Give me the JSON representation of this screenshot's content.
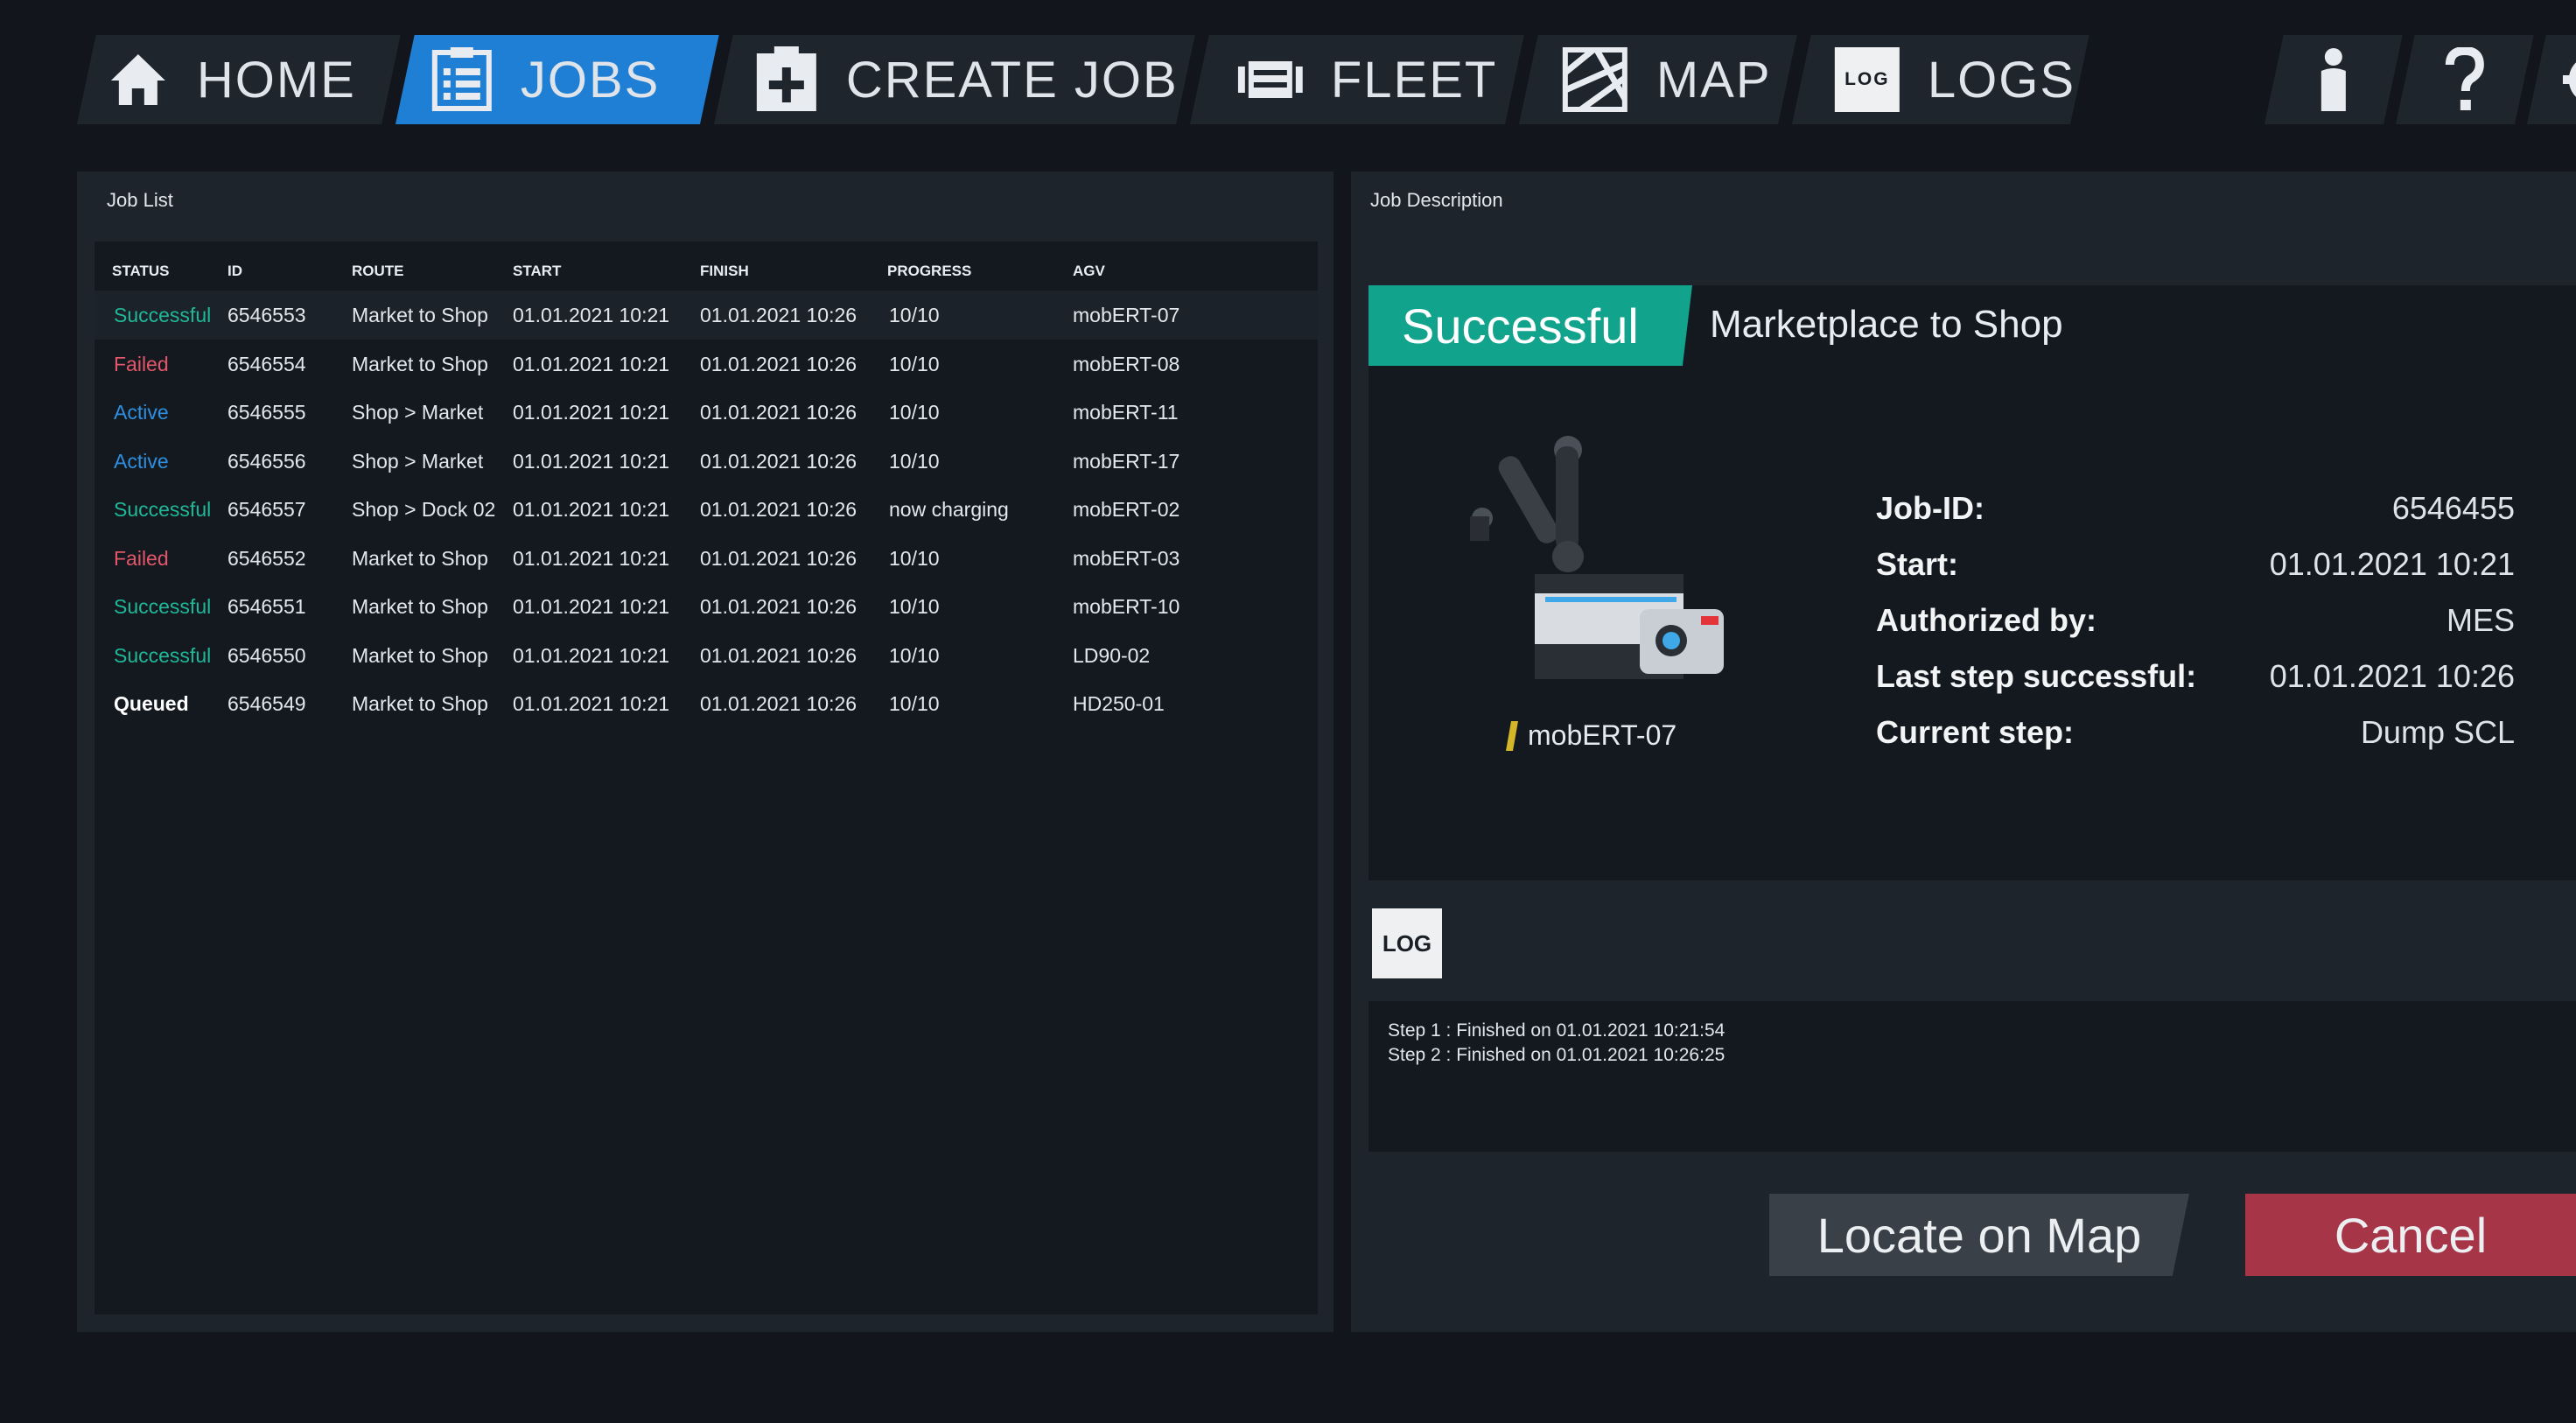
{
  "nav": {
    "tabs": [
      {
        "label": "HOME",
        "icon": "home-icon"
      },
      {
        "label": "JOBS",
        "icon": "job-list-icon",
        "active": true
      },
      {
        "label": "CREATE JOB",
        "icon": "add-job-icon"
      },
      {
        "label": "FLEET",
        "icon": "fleet-icon"
      },
      {
        "label": "MAP",
        "icon": "map-icon"
      },
      {
        "label": "LOGS",
        "icon": "log-icon",
        "icon_text": "LOG"
      }
    ],
    "utility": [
      {
        "icon": "user-icon"
      },
      {
        "icon": "help-icon"
      },
      {
        "icon": "gear-icon"
      }
    ]
  },
  "job_list": {
    "title": "Job List",
    "columns": [
      "STATUS",
      "ID",
      "ROUTE",
      "START",
      "FINISH",
      "PROGRESS",
      "AGV"
    ],
    "rows": [
      {
        "status": "Successful",
        "id": "6546553",
        "route": "Market to Shop",
        "start": "01.01.2021 10:21",
        "finish": "01.01.2021 10:26",
        "progress": "10/10",
        "agv": "mobERT-07"
      },
      {
        "status": "Failed",
        "id": "6546554",
        "route": "Market to Shop",
        "start": "01.01.2021 10:21",
        "finish": "01.01.2021 10:26",
        "progress": "10/10",
        "agv": "mobERT-08"
      },
      {
        "status": "Active",
        "id": "6546555",
        "route": "Shop > Market",
        "start": "01.01.2021 10:21",
        "finish": "01.01.2021 10:26",
        "progress": "10/10",
        "agv": "mobERT-11"
      },
      {
        "status": "Active",
        "id": "6546556",
        "route": "Shop > Market",
        "start": "01.01.2021 10:21",
        "finish": "01.01.2021 10:26",
        "progress": "10/10",
        "agv": "mobERT-17"
      },
      {
        "status": "Successful",
        "id": "6546557",
        "route": "Shop > Dock 02",
        "start": "01.01.2021 10:21",
        "finish": "01.01.2021 10:26",
        "progress": "now charging",
        "agv": "mobERT-02"
      },
      {
        "status": "Failed",
        "id": "6546552",
        "route": "Market to Shop",
        "start": "01.01.2021 10:21",
        "finish": "01.01.2021 10:26",
        "progress": "10/10",
        "agv": "mobERT-03"
      },
      {
        "status": "Successful",
        "id": "6546551",
        "route": "Market to Shop",
        "start": "01.01.2021 10:21",
        "finish": "01.01.2021 10:26",
        "progress": "10/10",
        "agv": "mobERT-10"
      },
      {
        "status": "Successful",
        "id": "6546550",
        "route": "Market to Shop",
        "start": "01.01.2021 10:21",
        "finish": "01.01.2021 10:26",
        "progress": "10/10",
        "agv": "LD90-02"
      },
      {
        "status": "Queued",
        "id": "6546549",
        "route": "Market to Shop",
        "start": "01.01.2021 10:21",
        "finish": "01.01.2021 10:26",
        "progress": "10/10",
        "agv": "HD250-01"
      }
    ]
  },
  "job_description": {
    "title": "Job Description",
    "status": "Successful",
    "route_title": "Marketplace to Shop",
    "agv_name": "mobERT-07",
    "details": [
      {
        "key": "Job-ID:",
        "value": "6546455"
      },
      {
        "key": "Start:",
        "value": "01.01.2021 10:21"
      },
      {
        "key": "Authorized by:",
        "value": "MES"
      },
      {
        "key": "Last step successful:",
        "value": "01.01.2021 10:26"
      },
      {
        "key": "Current step:",
        "value": "Dump SCL"
      }
    ],
    "log_button": "LOG",
    "log_lines": [
      "Step 1 : Finished on 01.01.2021 10:21:54",
      "Step 2 : Finished on 01.01.2021 10:26:25"
    ],
    "locate_button": "Locate on Map",
    "cancel_button": "Cancel"
  },
  "colors": {
    "active_tab": "#1f7fd4",
    "successful": "#1fb898",
    "failed": "#e3566a",
    "active": "#2e8fe0",
    "badge": "#12a38d",
    "cancel": "#a63547"
  }
}
